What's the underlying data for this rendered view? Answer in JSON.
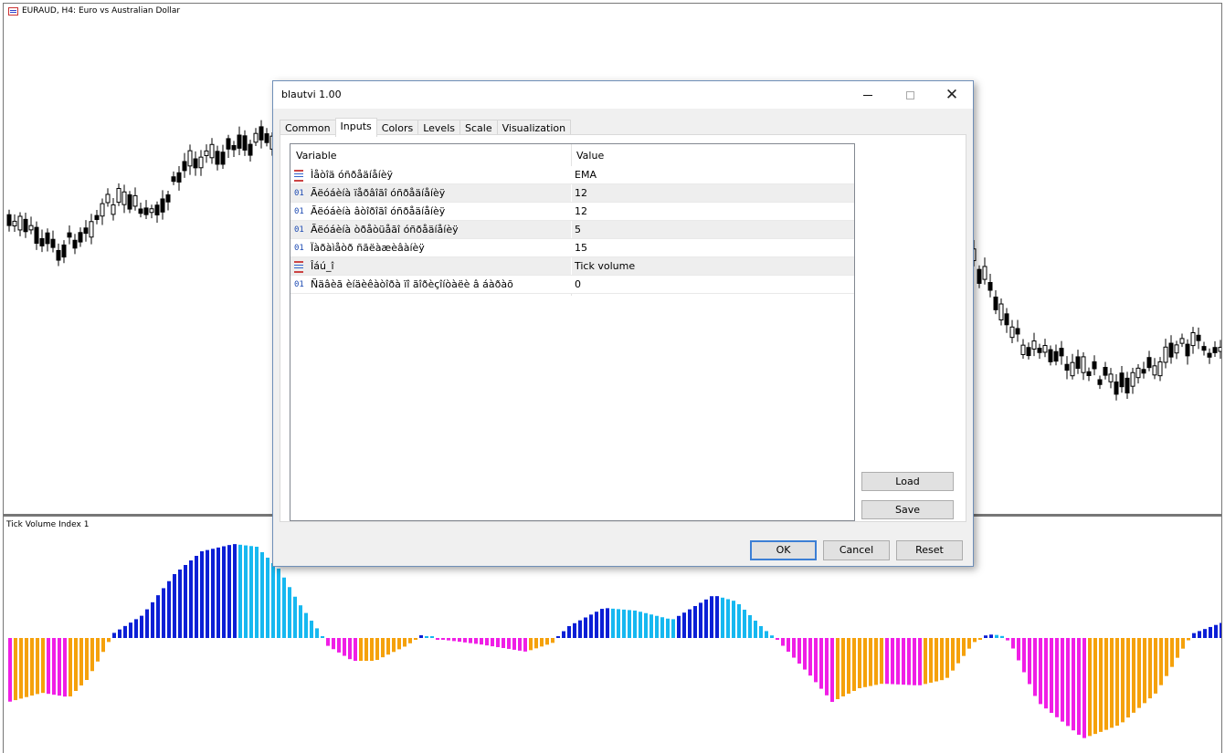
{
  "chart": {
    "title": "EURAUD, H4:  Euro vs Australian Dollar",
    "indicator_title": "Tick Volume Index 1",
    "colors": {
      "up_dark": "#0b1fd6",
      "up_light": "#16b8f0",
      "down_orange": "#f5a10b",
      "down_magenta": "#f01ee6"
    }
  },
  "dialog": {
    "title": "blautvi 1.00",
    "tabs": [
      "Common",
      "Inputs",
      "Colors",
      "Levels",
      "Scale",
      "Visualization"
    ],
    "active_tab": "Inputs",
    "table": {
      "headers": {
        "variable": "Variable",
        "value": "Value"
      },
      "rows": [
        {
          "type": "enum",
          "icon": "list-icon",
          "name": "Ìåòîä óñðåäíåíèÿ",
          "value": "EMA"
        },
        {
          "type": "int",
          "icon": "01",
          "name": "Ãëóáèíà ïåðâîãî óñðåäíåíèÿ",
          "value": "12"
        },
        {
          "type": "int",
          "icon": "01",
          "name": "Ãëóáèíà âòîðîãî óñðåäíåíèÿ",
          "value": "12"
        },
        {
          "type": "int",
          "icon": "01",
          "name": "Ãëóáèíà òðåòüåãî óñðåäíåíèÿ",
          "value": "5"
        },
        {
          "type": "int",
          "icon": "01",
          "name": "Ïàðàìåòð ñãëàæèâàíèÿ",
          "value": "15"
        },
        {
          "type": "enum",
          "icon": "list-icon",
          "name": "Îáú_î",
          "value": "Tick volume"
        },
        {
          "type": "int",
          "icon": "01",
          "name": "Ñäâèã èíäèêàòîðà ïî ãîðèçîíòàëè â áàðàõ",
          "value": "0"
        }
      ]
    },
    "buttons": {
      "load": "Load",
      "save": "Save",
      "ok": "OK",
      "cancel": "Cancel",
      "reset": "Reset"
    }
  }
}
